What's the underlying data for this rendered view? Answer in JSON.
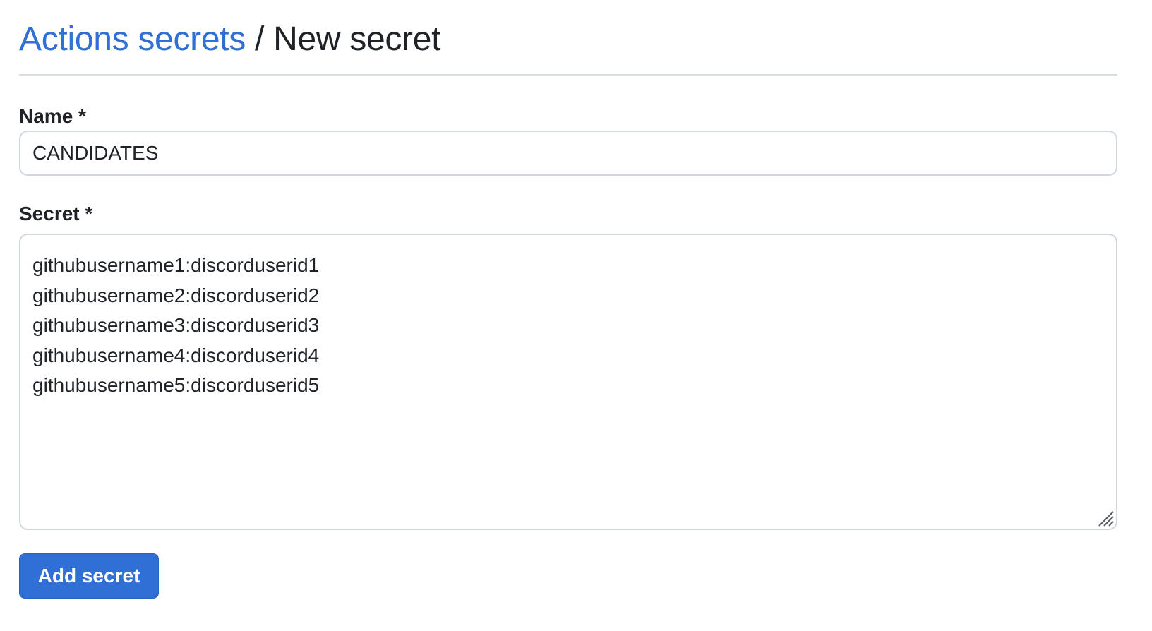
{
  "header": {
    "breadcrumb_link": "Actions secrets",
    "separator": " / ",
    "current": "New secret"
  },
  "form": {
    "name_label": "Name *",
    "name_value": "CANDIDATES",
    "secret_label": "Secret *",
    "secret_value": "githubusername1:discorduserid1\ngithubusername2:discorduserid2\ngithubusername3:discorduserid3\ngithubusername4:discorduserid4\ngithubusername5:discorduserid5",
    "submit_label": "Add secret"
  },
  "colors": {
    "link": "#2f6fd6",
    "button_bg": "#2f6fd6",
    "border": "#d0d7de",
    "divider": "#d8dee4",
    "text": "#1f2328"
  },
  "icons": {
    "resize_handle": "resize-grip-icon"
  }
}
